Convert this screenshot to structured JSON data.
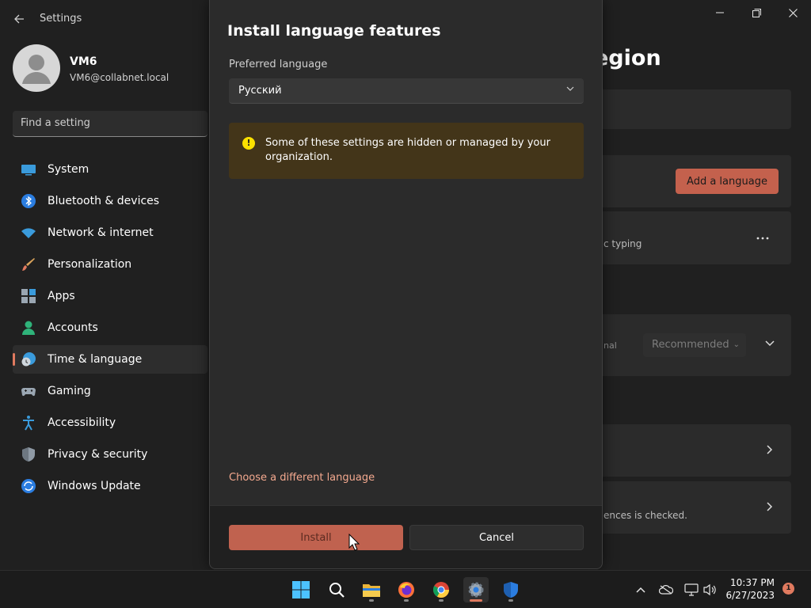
{
  "window": {
    "title": "Settings",
    "back_icon": "arrow-left-icon",
    "controls": [
      "minimize-icon",
      "maximize-icon",
      "close-icon"
    ]
  },
  "profile": {
    "name": "VM6",
    "email": "VM6@collabnet.local"
  },
  "search": {
    "placeholder": "Find a setting"
  },
  "sidebar": {
    "items": [
      {
        "label": "System",
        "icon": "monitor-icon"
      },
      {
        "label": "Bluetooth & devices",
        "icon": "bluetooth-icon"
      },
      {
        "label": "Network & internet",
        "icon": "wifi-icon"
      },
      {
        "label": "Personalization",
        "icon": "brush-icon"
      },
      {
        "label": "Apps",
        "icon": "apps-icon"
      },
      {
        "label": "Accounts",
        "icon": "person-icon"
      },
      {
        "label": "Time & language",
        "icon": "globe-clock-icon",
        "active": true
      },
      {
        "label": "Gaming",
        "icon": "gamepad-icon"
      },
      {
        "label": "Accessibility",
        "icon": "accessibility-icon"
      },
      {
        "label": "Privacy & security",
        "icon": "shield-icon"
      },
      {
        "label": "Windows Update",
        "icon": "update-icon"
      }
    ]
  },
  "background_page": {
    "heading": "egion",
    "add_language_label": "Add a language",
    "lang_card_sub": "c typing",
    "more_icon": "more-icon",
    "region_label": "nal",
    "regional_format_value": "Recommended",
    "typing_card_sub": "ences is checked."
  },
  "dialog": {
    "title": "Install language features",
    "preferred_label": "Preferred language",
    "preferred_value": "Русский",
    "warning_icon": "warning-icon",
    "warning_text": "Some of these settings are hidden or managed by your organization.",
    "choose_link": "Choose a different language",
    "install_label": "Install",
    "cancel_label": "Cancel"
  },
  "taskbar": {
    "apps": [
      "start-icon",
      "search-icon",
      "file-explorer-icon",
      "firefox-icon",
      "chrome-icon",
      "settings-icon",
      "defender-icon"
    ],
    "tray": [
      "chevron-up-icon",
      "onedrive-icon",
      "network-icon",
      "volume-icon"
    ],
    "time": "10:37 PM",
    "date": "6/27/2023",
    "notification_count": "1"
  },
  "colors": {
    "accent": "#e07a5f",
    "install_button": "#c0624f",
    "warning_background": "#433519",
    "warning_icon": "#fce100",
    "link": "#f4a98f"
  }
}
